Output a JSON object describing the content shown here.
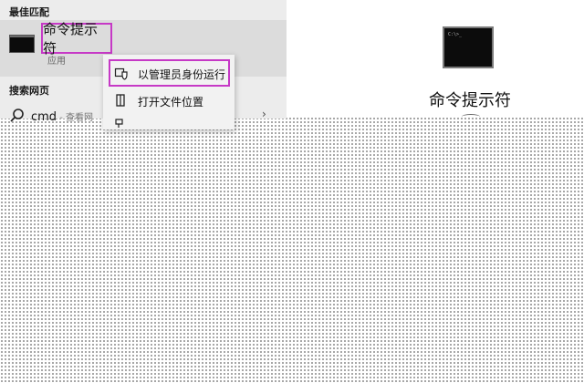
{
  "best_match": {
    "header": "最佳匹配",
    "app_name": "命令提示符",
    "app_type": "应用"
  },
  "web": {
    "header": "搜索网页",
    "query": "cmd",
    "suffix": " - 查看网"
  },
  "context_menu": {
    "items": [
      {
        "label": "以管理员身份运行",
        "icon": "shield-icon"
      },
      {
        "label": "打开文件位置",
        "icon": "folder-icon"
      }
    ]
  },
  "detail": {
    "title": "命令提示符",
    "icon": "cmd-icon"
  },
  "colors": {
    "highlight": "#c639c6",
    "panel": "#ececec",
    "selected": "#dcdcdc"
  }
}
